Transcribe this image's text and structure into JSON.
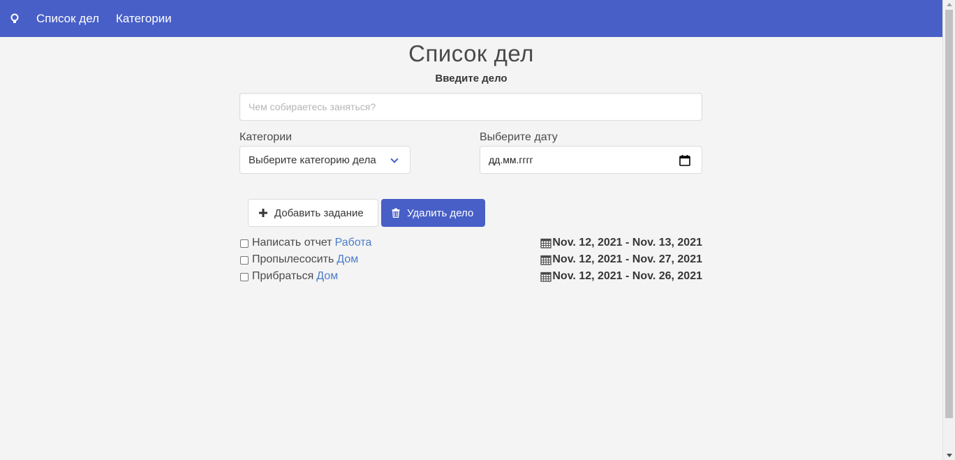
{
  "nav": {
    "logo_icon": "lightbulb-icon",
    "items": [
      "Список дел",
      "Категории"
    ]
  },
  "main": {
    "title": "Список дел",
    "subtitle": "Введите дело",
    "task_input": {
      "value": "",
      "placeholder": "Чем собираетесь заняться?"
    },
    "category": {
      "label": "Категории",
      "selected": "Выберите категорию дела"
    },
    "date": {
      "label": "Выберите дату",
      "value": "дд.мм.гггг"
    },
    "buttons": {
      "add": "Добавить задание",
      "delete": "Удалить дело"
    }
  },
  "todos": [
    {
      "text": "Написать отчет",
      "category": "Работа",
      "dates": "Nov. 12, 2021 - Nov. 13, 2021",
      "checked": false
    },
    {
      "text": "Пропылесосить",
      "category": "Дом",
      "dates": "Nov. 12, 2021 - Nov. 27, 2021",
      "checked": false
    },
    {
      "text": "Прибраться",
      "category": "Дом",
      "dates": "Nov. 12, 2021 - Nov. 26, 2021",
      "checked": false
    }
  ],
  "colors": {
    "primary": "#485fc7",
    "link": "#4a7cc9",
    "background": "#f4f4f4"
  }
}
